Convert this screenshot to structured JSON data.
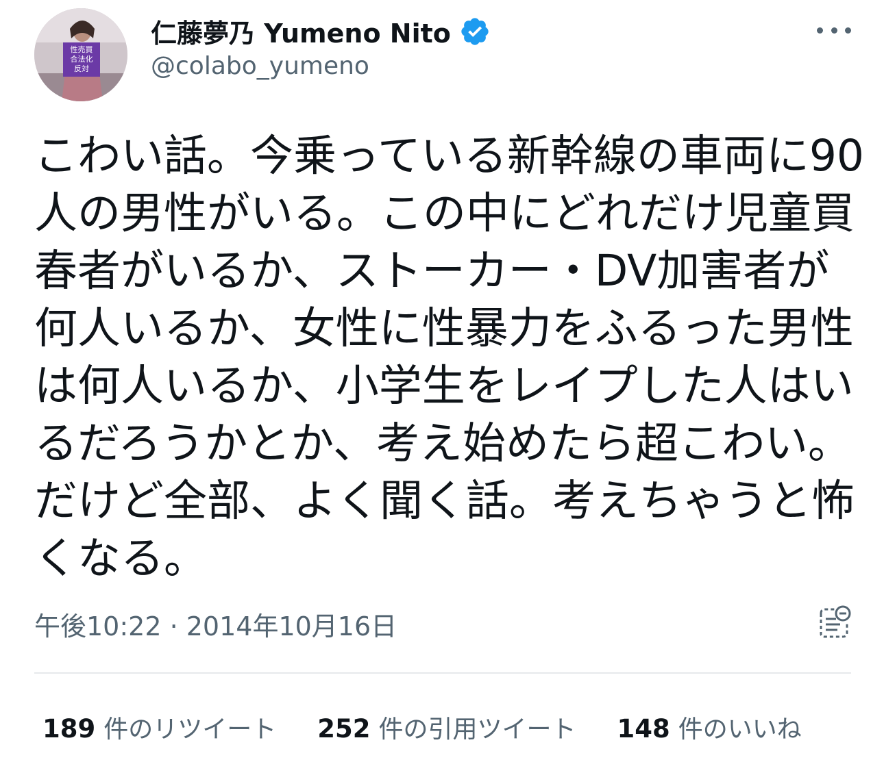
{
  "author": {
    "display_name": "仁藤夢乃 Yumeno Nito",
    "handle": "@colabo_yumeno",
    "avatar_sign_text": [
      "性売買",
      "合法化",
      "反対"
    ],
    "verified_icon": "verified-badge-icon",
    "verified_color": "#1d9bf0"
  },
  "tweet": {
    "lines": [
      "こわい話。今乗っている新幹線の車両に90",
      "人の男性がいる。この中にどれだけ児童買",
      "春者がいるか、ストーカー・DV加害者が",
      "何人いるか、女性に性暴力をふるった男性",
      "は何人いるか、小学生をレイプした人はい",
      "るだろうかとか、考え始めたら超こわい。",
      "だけど全部、よく聞く話。考えちゃうと怖",
      "くなる。"
    ],
    "timestamp": "午後10:22 · 2014年10月16日"
  },
  "stats": [
    {
      "count": "189",
      "label": "件のリツイート"
    },
    {
      "count": "252",
      "label": "件の引用ツイート"
    },
    {
      "count": "148",
      "label": "件のいいね"
    }
  ],
  "icons": {
    "more": "more-options-icon",
    "analytics": "tweet-analytics-icon"
  },
  "colors": {
    "text": "#0f1419",
    "secondary": "#536471",
    "accent": "#1d9bf0",
    "sign": "#6b3aa6"
  }
}
